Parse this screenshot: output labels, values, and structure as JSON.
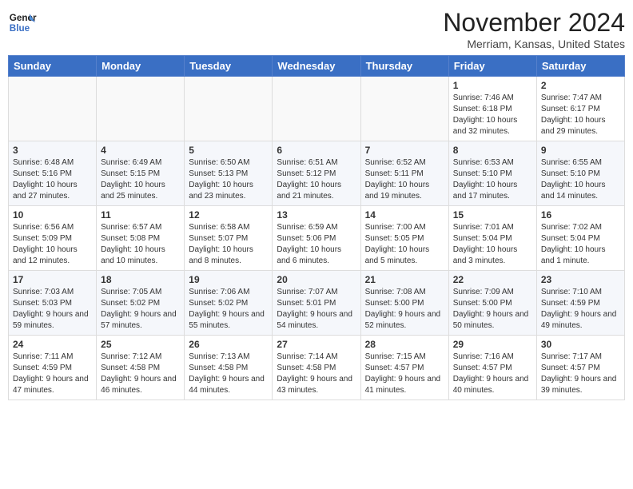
{
  "header": {
    "logo_line1": "General",
    "logo_line2": "Blue",
    "month": "November 2024",
    "location": "Merriam, Kansas, United States"
  },
  "weekdays": [
    "Sunday",
    "Monday",
    "Tuesday",
    "Wednesday",
    "Thursday",
    "Friday",
    "Saturday"
  ],
  "weeks": [
    [
      {
        "day": "",
        "info": ""
      },
      {
        "day": "",
        "info": ""
      },
      {
        "day": "",
        "info": ""
      },
      {
        "day": "",
        "info": ""
      },
      {
        "day": "",
        "info": ""
      },
      {
        "day": "1",
        "info": "Sunrise: 7:46 AM\nSunset: 6:18 PM\nDaylight: 10 hours and 32 minutes."
      },
      {
        "day": "2",
        "info": "Sunrise: 7:47 AM\nSunset: 6:17 PM\nDaylight: 10 hours and 29 minutes."
      }
    ],
    [
      {
        "day": "3",
        "info": "Sunrise: 6:48 AM\nSunset: 5:16 PM\nDaylight: 10 hours and 27 minutes."
      },
      {
        "day": "4",
        "info": "Sunrise: 6:49 AM\nSunset: 5:15 PM\nDaylight: 10 hours and 25 minutes."
      },
      {
        "day": "5",
        "info": "Sunrise: 6:50 AM\nSunset: 5:13 PM\nDaylight: 10 hours and 23 minutes."
      },
      {
        "day": "6",
        "info": "Sunrise: 6:51 AM\nSunset: 5:12 PM\nDaylight: 10 hours and 21 minutes."
      },
      {
        "day": "7",
        "info": "Sunrise: 6:52 AM\nSunset: 5:11 PM\nDaylight: 10 hours and 19 minutes."
      },
      {
        "day": "8",
        "info": "Sunrise: 6:53 AM\nSunset: 5:10 PM\nDaylight: 10 hours and 17 minutes."
      },
      {
        "day": "9",
        "info": "Sunrise: 6:55 AM\nSunset: 5:10 PM\nDaylight: 10 hours and 14 minutes."
      }
    ],
    [
      {
        "day": "10",
        "info": "Sunrise: 6:56 AM\nSunset: 5:09 PM\nDaylight: 10 hours and 12 minutes."
      },
      {
        "day": "11",
        "info": "Sunrise: 6:57 AM\nSunset: 5:08 PM\nDaylight: 10 hours and 10 minutes."
      },
      {
        "day": "12",
        "info": "Sunrise: 6:58 AM\nSunset: 5:07 PM\nDaylight: 10 hours and 8 minutes."
      },
      {
        "day": "13",
        "info": "Sunrise: 6:59 AM\nSunset: 5:06 PM\nDaylight: 10 hours and 6 minutes."
      },
      {
        "day": "14",
        "info": "Sunrise: 7:00 AM\nSunset: 5:05 PM\nDaylight: 10 hours and 5 minutes."
      },
      {
        "day": "15",
        "info": "Sunrise: 7:01 AM\nSunset: 5:04 PM\nDaylight: 10 hours and 3 minutes."
      },
      {
        "day": "16",
        "info": "Sunrise: 7:02 AM\nSunset: 5:04 PM\nDaylight: 10 hours and 1 minute."
      }
    ],
    [
      {
        "day": "17",
        "info": "Sunrise: 7:03 AM\nSunset: 5:03 PM\nDaylight: 9 hours and 59 minutes."
      },
      {
        "day": "18",
        "info": "Sunrise: 7:05 AM\nSunset: 5:02 PM\nDaylight: 9 hours and 57 minutes."
      },
      {
        "day": "19",
        "info": "Sunrise: 7:06 AM\nSunset: 5:02 PM\nDaylight: 9 hours and 55 minutes."
      },
      {
        "day": "20",
        "info": "Sunrise: 7:07 AM\nSunset: 5:01 PM\nDaylight: 9 hours and 54 minutes."
      },
      {
        "day": "21",
        "info": "Sunrise: 7:08 AM\nSunset: 5:00 PM\nDaylight: 9 hours and 52 minutes."
      },
      {
        "day": "22",
        "info": "Sunrise: 7:09 AM\nSunset: 5:00 PM\nDaylight: 9 hours and 50 minutes."
      },
      {
        "day": "23",
        "info": "Sunrise: 7:10 AM\nSunset: 4:59 PM\nDaylight: 9 hours and 49 minutes."
      }
    ],
    [
      {
        "day": "24",
        "info": "Sunrise: 7:11 AM\nSunset: 4:59 PM\nDaylight: 9 hours and 47 minutes."
      },
      {
        "day": "25",
        "info": "Sunrise: 7:12 AM\nSunset: 4:58 PM\nDaylight: 9 hours and 46 minutes."
      },
      {
        "day": "26",
        "info": "Sunrise: 7:13 AM\nSunset: 4:58 PM\nDaylight: 9 hours and 44 minutes."
      },
      {
        "day": "27",
        "info": "Sunrise: 7:14 AM\nSunset: 4:58 PM\nDaylight: 9 hours and 43 minutes."
      },
      {
        "day": "28",
        "info": "Sunrise: 7:15 AM\nSunset: 4:57 PM\nDaylight: 9 hours and 41 minutes."
      },
      {
        "day": "29",
        "info": "Sunrise: 7:16 AM\nSunset: 4:57 PM\nDaylight: 9 hours and 40 minutes."
      },
      {
        "day": "30",
        "info": "Sunrise: 7:17 AM\nSunset: 4:57 PM\nDaylight: 9 hours and 39 minutes."
      }
    ]
  ]
}
